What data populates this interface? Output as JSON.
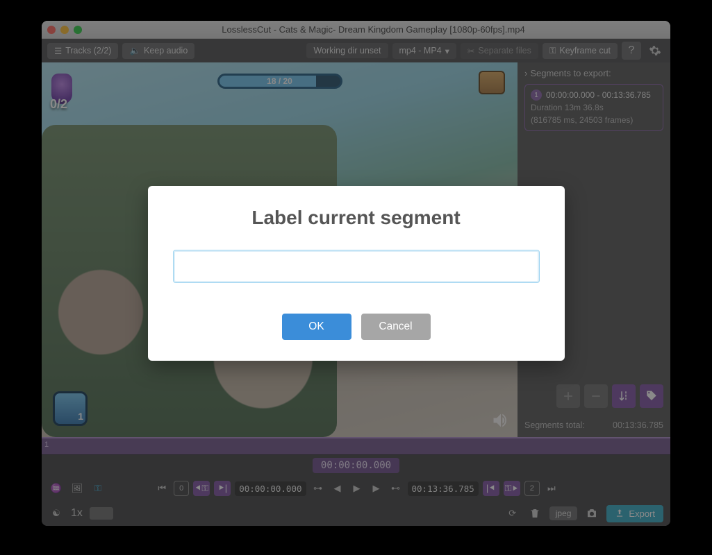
{
  "window": {
    "title": "LosslessCut - Cats & Magic- Dream Kingdom Gameplay [1080p-60fps].mp4"
  },
  "toolbar": {
    "tracks": "Tracks (2/2)",
    "keep_audio": "Keep audio",
    "working_dir": "Working dir unset",
    "format": "mp4 - MP4",
    "separate": "Separate files",
    "keyframe": "Keyframe cut"
  },
  "game_hud": {
    "progress": "18 / 20",
    "counter": "0/2",
    "avatar_num": "1"
  },
  "sidebar": {
    "header": "Segments to export:",
    "segment": {
      "index": "1",
      "range": "00:00:00.000 - 00:13:36.785",
      "duration": "Duration 13m 36.8s",
      "details": "(816785 ms, 24503 frames)"
    },
    "total_label": "Segments total:",
    "total_value": "00:13:36.785"
  },
  "timeline": {
    "current": "00:00:00.000",
    "start": "00:00:00.000",
    "end": "00:13:36.785",
    "zero": "0",
    "two": "2"
  },
  "bottom": {
    "speed": "1x",
    "jpeg": "jpeg",
    "export": "Export"
  },
  "modal": {
    "title": "Label current segment",
    "ok": "OK",
    "cancel": "Cancel"
  }
}
